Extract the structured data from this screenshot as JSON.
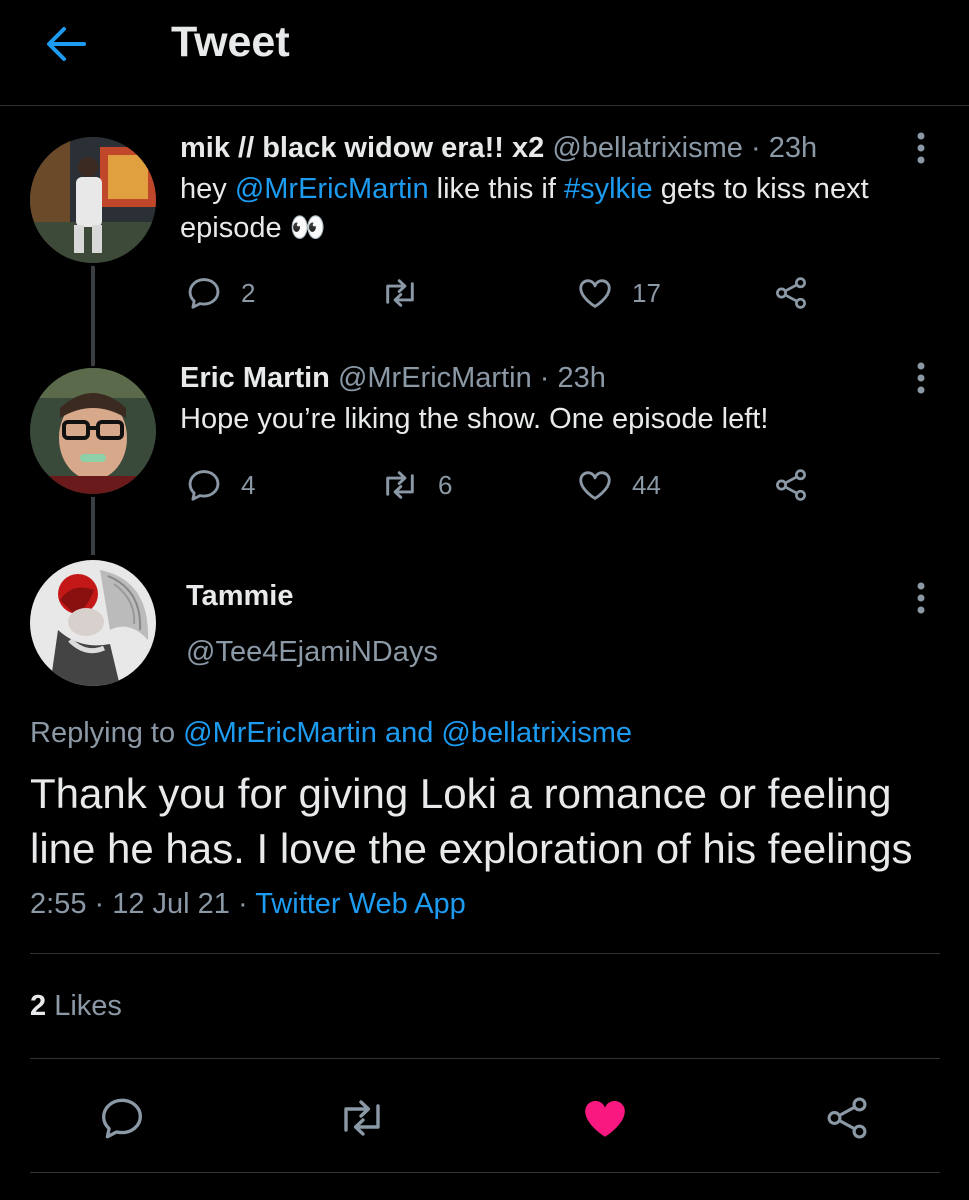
{
  "header": {
    "title": "Tweet"
  },
  "thread": [
    {
      "name": "mik // black widow era!! x2",
      "handle": "@bellatrixisme",
      "time": "23h",
      "text_parts": [
        "hey ",
        "@MrEricMartin",
        " like this if ",
        "#sylkie",
        " gets to kiss next episode ",
        "👀"
      ],
      "replies": "2",
      "retweets": "",
      "likes": "17"
    },
    {
      "name": "Eric Martin",
      "handle": "@MrEricMartin",
      "time": "23h",
      "text": "Hope you’re liking the show. One episode left!",
      "replies": "4",
      "retweets": "6",
      "likes": "44"
    }
  ],
  "focused": {
    "name": "Tammie",
    "handle": "@Tee4EjamiNDays",
    "replying_prefix": "Replying to ",
    "replying_to": "@MrEricMartin and @bellatrixisme",
    "text": "Thank you for giving Loki a romance or feeling line he has. I love the exploration of his feelings",
    "time": "2:55",
    "date": "12 Jul 21",
    "source": "Twitter Web App",
    "likes_count": "2",
    "likes_label": "Likes",
    "liked": true
  },
  "colors": {
    "accent": "#1d9bf0",
    "like_active": "#f91880",
    "background": "#000000"
  },
  "icons": [
    "back-arrow-icon",
    "more-vertical-icon",
    "reply-icon",
    "retweet-icon",
    "heart-icon",
    "share-icon"
  ]
}
